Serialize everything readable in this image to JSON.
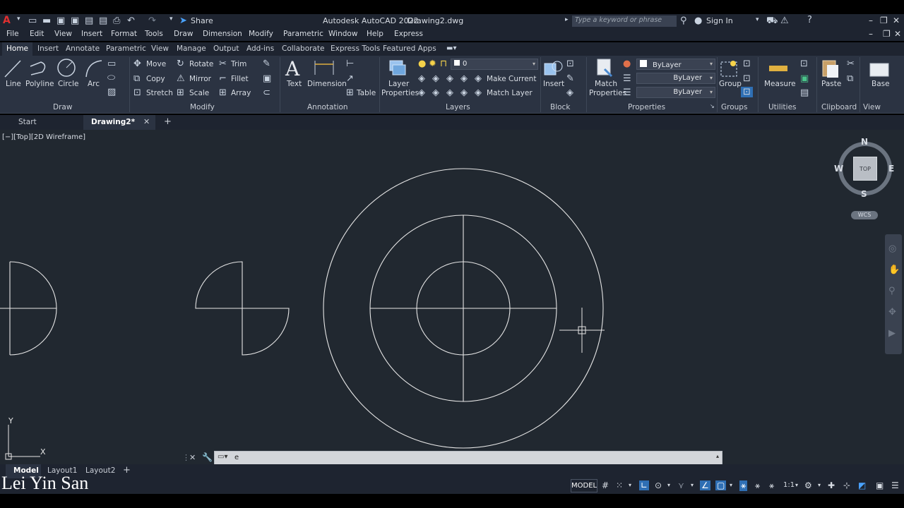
{
  "app": {
    "title": "Autodesk AutoCAD 2022",
    "file": "Drawing2.dwg",
    "share": "Share",
    "search_placeholder": "Type a keyword or phrase",
    "sign_in": "Sign In",
    "logo_letter": "A"
  },
  "menu": [
    "File",
    "Edit",
    "View",
    "Insert",
    "Format",
    "Tools",
    "Draw",
    "Dimension",
    "Modify",
    "Parametric",
    "Window",
    "Help",
    "Express"
  ],
  "ribbon_tabs": [
    "Home",
    "Insert",
    "Annotate",
    "Parametric",
    "View",
    "Manage",
    "Output",
    "Add-ins",
    "Collaborate",
    "Express Tools",
    "Featured Apps"
  ],
  "ribbon": {
    "draw": {
      "line": "Line",
      "polyline": "Polyline",
      "circle": "Circle",
      "arc": "Arc",
      "title": "Draw"
    },
    "modify": {
      "move": "Move",
      "rotate": "Rotate",
      "trim": "Trim",
      "copy": "Copy",
      "mirror": "Mirror",
      "fillet": "Fillet",
      "stretch": "Stretch",
      "scale": "Scale",
      "array": "Array",
      "title": "Modify"
    },
    "annotation": {
      "text": "Text",
      "dimension": "Dimension",
      "table": "Table",
      "title": "Annotation"
    },
    "layers": {
      "layer_properties_1": "Layer",
      "layer_properties_2": "Properties",
      "current_layer": "0",
      "make_current": "Make Current",
      "match_layer": "Match Layer",
      "title": "Layers"
    },
    "block": {
      "insert": "Insert",
      "title": "Block"
    },
    "properties": {
      "match_1": "Match",
      "match_2": "Properties",
      "color": "ByLayer",
      "linetype": "ByLayer",
      "lineweight": "ByLayer",
      "title": "Properties"
    },
    "groups": {
      "group": "Group",
      "title": "Groups"
    },
    "utilities": {
      "measure": "Measure",
      "title": "Utilities"
    },
    "clipboard": {
      "paste": "Paste",
      "title": "Clipboard"
    },
    "view": {
      "base": "Base",
      "title": "View"
    }
  },
  "doc_tabs": {
    "start": "Start",
    "drawing": "Drawing2*"
  },
  "viewport": {
    "label": "[−][Top][2D Wireframe]",
    "compass": {
      "n": "N",
      "s": "S",
      "e": "E",
      "w": "W",
      "cube": "TOP",
      "wcs": "WCS"
    },
    "ucs": {
      "y": "Y",
      "x": "X"
    }
  },
  "command_line": {
    "text": "e"
  },
  "layout_tabs": [
    "Model",
    "Layout1",
    "Layout2"
  ],
  "status": {
    "model": "MODEL",
    "scale": "1:1"
  },
  "watermark": "Lei Yin San",
  "colors": {
    "canvas": "#212830",
    "ribbon": "#2b3342",
    "accent": "#2f6fb4",
    "geometry": "#e6e6e6"
  }
}
